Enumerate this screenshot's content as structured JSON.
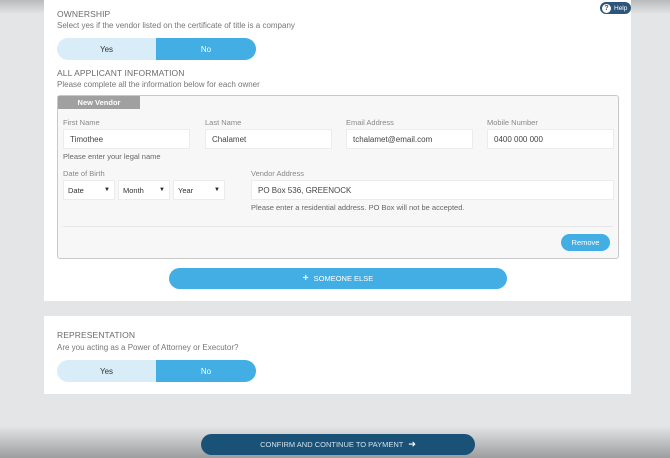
{
  "help": {
    "label": "Help",
    "icon": "help-icon"
  },
  "ownership": {
    "title": "OWNERSHIP",
    "subtitle": "Select yes if the vendor listed on the certificate of title is a company",
    "toggle": {
      "yes": "Yes",
      "no": "No",
      "selected": "No"
    }
  },
  "applicants": {
    "title": "ALL APPLICANT INFORMATION",
    "subtitle": "Please complete all the information below for each owner",
    "vendor": {
      "tab_label": "New Vendor",
      "first_name": {
        "label": "First Name",
        "value": "Timothee",
        "hint": "Please enter your legal name"
      },
      "last_name": {
        "label": "Last Name",
        "value": "Chalamet"
      },
      "email": {
        "label": "Email Address",
        "value": "tchalamet@email.com"
      },
      "mobile": {
        "label": "Mobile Number",
        "value": "0400 000 000"
      },
      "dob": {
        "label": "Date of Birth",
        "date": "Date",
        "month": "Month",
        "year": "Year"
      },
      "address": {
        "label": "Vendor Address",
        "value": "PO Box 536, GREENOCK",
        "hint": "Please enter a residential address. PO Box will not be accepted."
      },
      "remove_label": "Remove"
    },
    "someone_else_label": "SOMEONE ELSE"
  },
  "representation": {
    "title": "REPRESENTATION",
    "subtitle": "Are you acting as a Power of Attorney or Executor?",
    "toggle": {
      "yes": "Yes",
      "no": "No",
      "selected": "No"
    }
  },
  "footer": {
    "confirm_label": "CONFIRM AND CONTINUE TO PAYMENT"
  },
  "colors": {
    "accent": "#43aee4",
    "accent_light": "#d9edf8",
    "primary_dark": "#1a5277",
    "help_bg": "#2d5579"
  }
}
